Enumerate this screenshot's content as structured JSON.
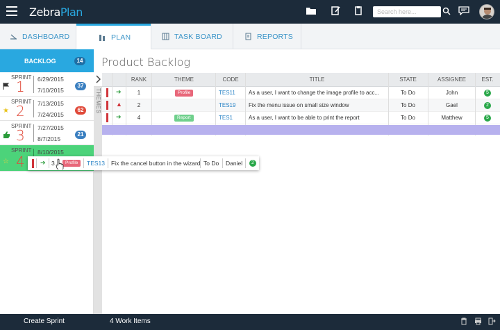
{
  "app": {
    "logo_prefix": "Zebra",
    "logo_suffix": "Plan",
    "search_placeholder": "Search here...",
    "brand_color": "#29a8e0",
    "topbar_color": "#1c2b3a"
  },
  "nav": {
    "tabs": [
      {
        "label": "DASHBOARD",
        "icon": "dashboard-icon",
        "active": false
      },
      {
        "label": "PLAN",
        "icon": "plan-icon",
        "active": true
      },
      {
        "label": "TASK BOARD",
        "icon": "taskboard-icon",
        "active": false
      },
      {
        "label": "REPORTS",
        "icon": "reports-icon",
        "active": false
      }
    ]
  },
  "sidebar": {
    "backlog_label": "BACKLOG",
    "backlog_count": "14",
    "sprints": [
      {
        "word": "SPRINT",
        "num": "1",
        "start": "6/29/2015",
        "end": "7/10/2015",
        "count": "37",
        "badge_color": "#3a7fc0",
        "icon": "flag-icon"
      },
      {
        "word": "SPRINT",
        "num": "2",
        "start": "7/13/2015",
        "end": "7/24/2015",
        "count": "62",
        "badge_color": "#e04a3a",
        "icon": "star-icon"
      },
      {
        "word": "SPRINT",
        "num": "3",
        "start": "7/27/2015",
        "end": "8/7/2015",
        "count": "21",
        "badge_color": "#3a7fc0",
        "icon": "thumbs-up-icon"
      },
      {
        "word": "SPRINT",
        "num": "4",
        "start": "8/10/2015",
        "end": "",
        "count": "",
        "badge_color": "",
        "icon": "star-outline-icon"
      }
    ]
  },
  "main": {
    "title": "Product Backlog",
    "themes_label": "THEMES",
    "columns": [
      "RANK",
      "THEME",
      "CODE",
      "TITLE",
      "STATE",
      "ASSIGNEE",
      "EST."
    ],
    "rows": [
      {
        "arrow": "green",
        "rank": "1",
        "theme": "Profile",
        "code": "TES11",
        "title": "As a user, I want to change the image profile to acc...",
        "state": "To Do",
        "assignee": "John",
        "est": "5"
      },
      {
        "arrow": "red",
        "rank": "2",
        "theme": "",
        "code": "TES19",
        "title": "Fix the menu issue on small size window",
        "state": "To Do",
        "assignee": "Gael",
        "est": "2"
      },
      {
        "arrow": "green",
        "rank": "4",
        "theme": "Report",
        "code": "TES1",
        "title": "As a user, I want to be able to print the report",
        "state": "To Do",
        "assignee": "Matthew",
        "est": "5"
      }
    ]
  },
  "dragged": {
    "rank": "3",
    "theme": "Profile",
    "code": "TES13",
    "title": "Fix the cancel button in the wizard",
    "state": "To Do",
    "assignee": "Daniel",
    "est": "2"
  },
  "bottom": {
    "create_sprint": "Create Sprint",
    "work_items": "4 Work Items"
  }
}
